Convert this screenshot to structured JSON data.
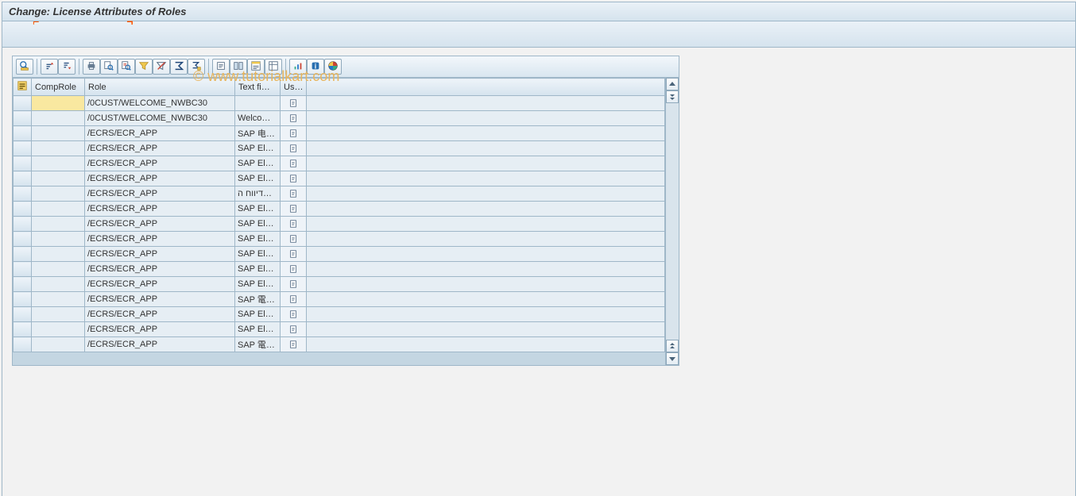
{
  "window": {
    "title": "Change: License Attributes of Roles"
  },
  "watermark": "© www.tutorialkart.com",
  "toolbar": {
    "buttons": [
      {
        "name": "details-icon",
        "group": 0
      },
      {
        "name": "sort-asc-icon",
        "group": 1
      },
      {
        "name": "sort-desc-icon",
        "group": 1
      },
      {
        "name": "print-icon",
        "group": 2
      },
      {
        "name": "find-icon",
        "group": 2
      },
      {
        "name": "find-next-icon",
        "group": 2
      },
      {
        "name": "set-filter-icon",
        "group": 2
      },
      {
        "name": "filter-icon",
        "group": 2
      },
      {
        "name": "total-icon",
        "group": 2
      },
      {
        "name": "subtotal-icon",
        "group": 2
      },
      {
        "name": "export-icon",
        "group": 3
      },
      {
        "name": "views-icon",
        "group": 3
      },
      {
        "name": "select-layout-icon",
        "group": 3
      },
      {
        "name": "change-layout-icon",
        "group": 3
      },
      {
        "name": "graphic-icon",
        "group": 4
      },
      {
        "name": "info-icon",
        "group": 4
      },
      {
        "name": "color-legend-icon",
        "group": 4
      }
    ]
  },
  "grid": {
    "columns": {
      "comp": "CompRole",
      "role": "Role",
      "text": "Text fi…",
      "us": "Us…"
    },
    "rows": [
      {
        "comp": "",
        "role": "/0CUST/WELCOME_NWBC30",
        "text": "",
        "highlightComp": true
      },
      {
        "comp": "",
        "role": "/0CUST/WELCOME_NWBC30",
        "text": "Welco…"
      },
      {
        "comp": "",
        "role": "/ECRS/ECR_APP",
        "text": "SAP 电…"
      },
      {
        "comp": "",
        "role": "/ECRS/ECR_APP",
        "text": "SAP El…"
      },
      {
        "comp": "",
        "role": "/ECRS/ECR_APP",
        "text": "SAP El…"
      },
      {
        "comp": "",
        "role": "/ECRS/ECR_APP",
        "text": "SAP El…"
      },
      {
        "comp": "",
        "role": "/ECRS/ECR_APP",
        "text": "דיווח ה…"
      },
      {
        "comp": "",
        "role": "/ECRS/ECR_APP",
        "text": "SAP El…"
      },
      {
        "comp": "",
        "role": "/ECRS/ECR_APP",
        "text": "SAP El…"
      },
      {
        "comp": "",
        "role": "/ECRS/ECR_APP",
        "text": "SAP El…"
      },
      {
        "comp": "",
        "role": "/ECRS/ECR_APP",
        "text": "SAP El…"
      },
      {
        "comp": "",
        "role": "/ECRS/ECR_APP",
        "text": "SAP El…"
      },
      {
        "comp": "",
        "role": "/ECRS/ECR_APP",
        "text": "SAP El…"
      },
      {
        "comp": "",
        "role": "/ECRS/ECR_APP",
        "text": "SAP 電…"
      },
      {
        "comp": "",
        "role": "/ECRS/ECR_APP",
        "text": "SAP El…"
      },
      {
        "comp": "",
        "role": "/ECRS/ECR_APP",
        "text": "SAP El…"
      },
      {
        "comp": "",
        "role": "/ECRS/ECR_APP",
        "text": "SAP 電…"
      }
    ]
  }
}
